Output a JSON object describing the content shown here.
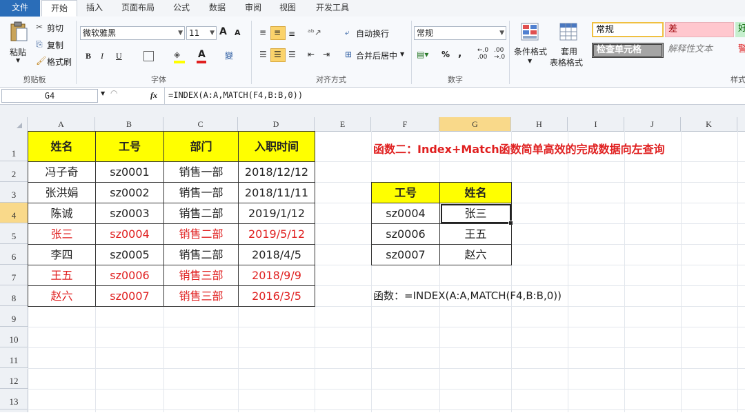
{
  "tabs": [
    "文件",
    "开始",
    "插入",
    "页面布局",
    "公式",
    "数据",
    "审阅",
    "视图",
    "开发工具"
  ],
  "ribbon": {
    "clipboard": {
      "paste": "粘贴",
      "cut": "剪切",
      "copy": "复制",
      "format_painter": "格式刷",
      "label": "剪贴板"
    },
    "font": {
      "name": "微软雅黑",
      "size": "11",
      "grow": "A",
      "shrink": "A",
      "bold": "B",
      "italic": "I",
      "underline": "U",
      "fill_letter": "A",
      "label": "字体",
      "phonetic": "變"
    },
    "align": {
      "wrap": "自动换行",
      "merge": "合并后居中",
      "label": "对齐方式"
    },
    "number": {
      "format": "常规",
      "percent": "%",
      "comma": ",",
      "inc_dec": ".0\n.00",
      "label": "数字"
    },
    "styles": {
      "cond_format": "条件格式",
      "table_format_1": "套用",
      "table_format_2": "表格格式",
      "normal": "常规",
      "bad": "差",
      "check": "检查单元格",
      "explain": "解释性文本",
      "good_partial": "好",
      "warn_partial": "警",
      "label": "样式"
    }
  },
  "formula_bar": {
    "name_box": "G4",
    "fx": "fx",
    "formula": "=INDEX(A:A,MATCH(F4,B:B,0))"
  },
  "columns": [
    "A",
    "B",
    "C",
    "D",
    "E",
    "F",
    "G",
    "H",
    "I",
    "J",
    "K"
  ],
  "rows": [
    "1",
    "2",
    "3",
    "4",
    "5",
    "6",
    "7",
    "8",
    "9",
    "10",
    "11",
    "12",
    "13"
  ],
  "table1": {
    "headers": [
      "姓名",
      "工号",
      "部门",
      "入职时间"
    ],
    "rows": [
      [
        "冯子奇",
        "sz0001",
        "销售一部",
        "2018/12/12"
      ],
      [
        "张洪娟",
        "sz0002",
        "销售一部",
        "2018/11/11"
      ],
      [
        "陈诚",
        "sz0003",
        "销售二部",
        "2019/1/12"
      ],
      [
        "张三",
        "sz0004",
        "销售二部",
        "2019/5/12"
      ],
      [
        "李四",
        "sz0005",
        "销售二部",
        "2018/4/5"
      ],
      [
        "王五",
        "sz0006",
        "销售三部",
        "2018/9/9"
      ],
      [
        "赵六",
        "sz0007",
        "销售三部",
        "2016/3/5"
      ]
    ],
    "red_rows": [
      3,
      5,
      6
    ],
    "header_color": "#ffff00",
    "highlight_color": "#e02020"
  },
  "title2": "函数二：Index+Match函数简单高效的完成数据向左查询",
  "table2": {
    "headers": [
      "工号",
      "姓名"
    ],
    "rows": [
      [
        "sz0004",
        "张三"
      ],
      [
        "sz0006",
        "王五"
      ],
      [
        "sz0007",
        "赵六"
      ]
    ]
  },
  "formula_note": "函数：=INDEX(A:A,MATCH(F4,B:B,0))",
  "selected_cell": "G4"
}
